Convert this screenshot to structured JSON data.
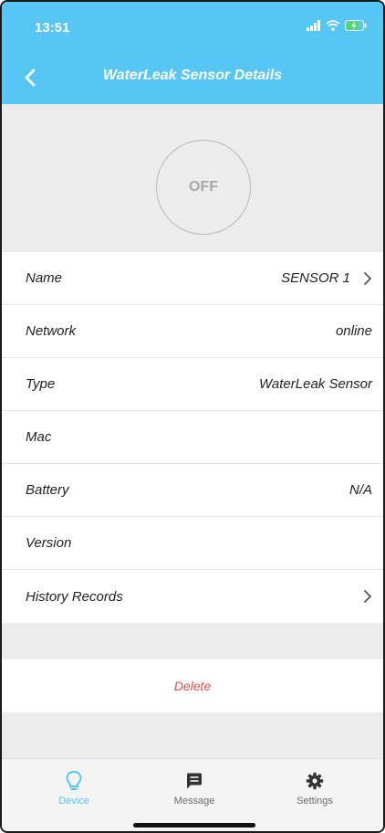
{
  "status_bar": {
    "time": "13:51"
  },
  "header": {
    "title": "WaterLeak Sensor Details",
    "background_color": "#56c6f5"
  },
  "power": {
    "state_label": "OFF"
  },
  "details": {
    "rows": [
      {
        "label": "Name",
        "value": "SENSOR 1",
        "has_chevron": true
      },
      {
        "label": "Network",
        "value": "online"
      },
      {
        "label": "Type",
        "value": "WaterLeak Sensor"
      },
      {
        "label": "Mac",
        "value": ""
      },
      {
        "label": "Battery",
        "value": "N/A"
      },
      {
        "label": "Version",
        "value": ""
      },
      {
        "label": "History Records",
        "value": "",
        "has_chevron": true
      }
    ]
  },
  "actions": {
    "delete_label": "Delete",
    "delete_color": "#ef4a4a"
  },
  "tab_bar": {
    "tabs": [
      {
        "label": "Device",
        "icon": "lightbulb-icon",
        "active": true
      },
      {
        "label": "Message",
        "icon": "message-icon",
        "active": false
      },
      {
        "label": "Settings",
        "icon": "gear-icon",
        "active": false
      }
    ],
    "active_color": "#56c6f5"
  }
}
